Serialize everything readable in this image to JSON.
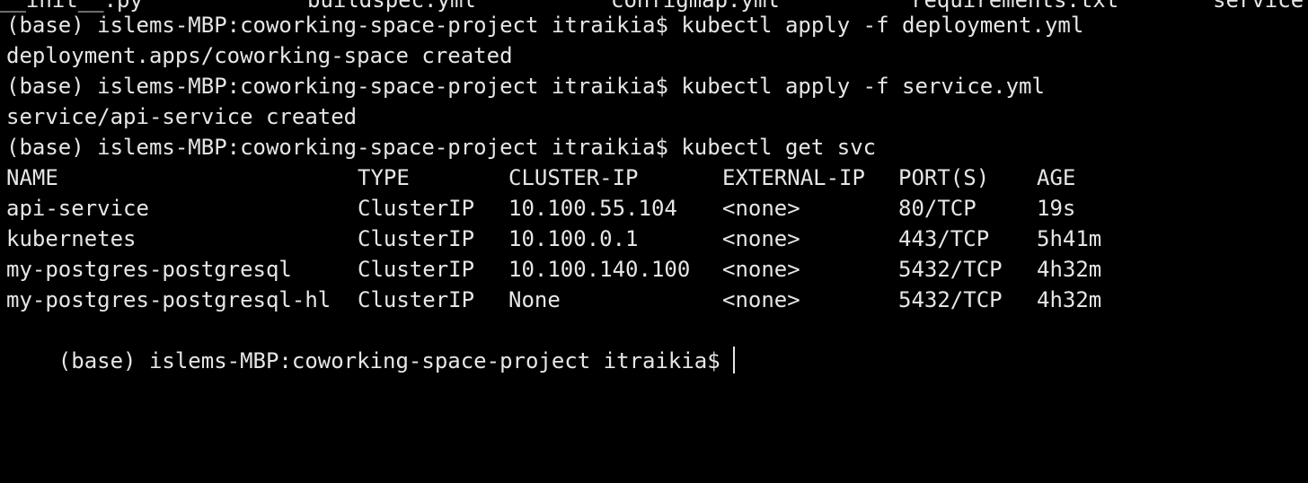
{
  "colors": {
    "background": "#000000",
    "text": "#e6e6e6"
  },
  "prev_listing": [
    "__init__.py",
    "buildspec.yml",
    "configmap.yml",
    "requirements.txt",
    "service"
  ],
  "lines": [
    "(base) islems-MBP:coworking-space-project itraikia$ kubectl apply -f deployment.yml",
    "deployment.apps/coworking-space created",
    "(base) islems-MBP:coworking-space-project itraikia$ kubectl apply -f service.yml",
    "service/api-service created",
    "(base) islems-MBP:coworking-space-project itraikia$ kubectl get svc"
  ],
  "table": {
    "headers": [
      "NAME",
      "TYPE",
      "CLUSTER-IP",
      "EXTERNAL-IP",
      "PORT(S)",
      "AGE"
    ],
    "rows": [
      [
        "api-service",
        "ClusterIP",
        "10.100.55.104",
        "<none>",
        "80/TCP",
        "19s"
      ],
      [
        "kubernetes",
        "ClusterIP",
        "10.100.0.1",
        "<none>",
        "443/TCP",
        "5h41m"
      ],
      [
        "my-postgres-postgresql",
        "ClusterIP",
        "10.100.140.100",
        "<none>",
        "5432/TCP",
        "4h32m"
      ],
      [
        "my-postgres-postgresql-hl",
        "ClusterIP",
        "None",
        "<none>",
        "5432/TCP",
        "4h32m"
      ]
    ]
  },
  "prompt": "(base) islems-MBP:coworking-space-project itraikia$"
}
